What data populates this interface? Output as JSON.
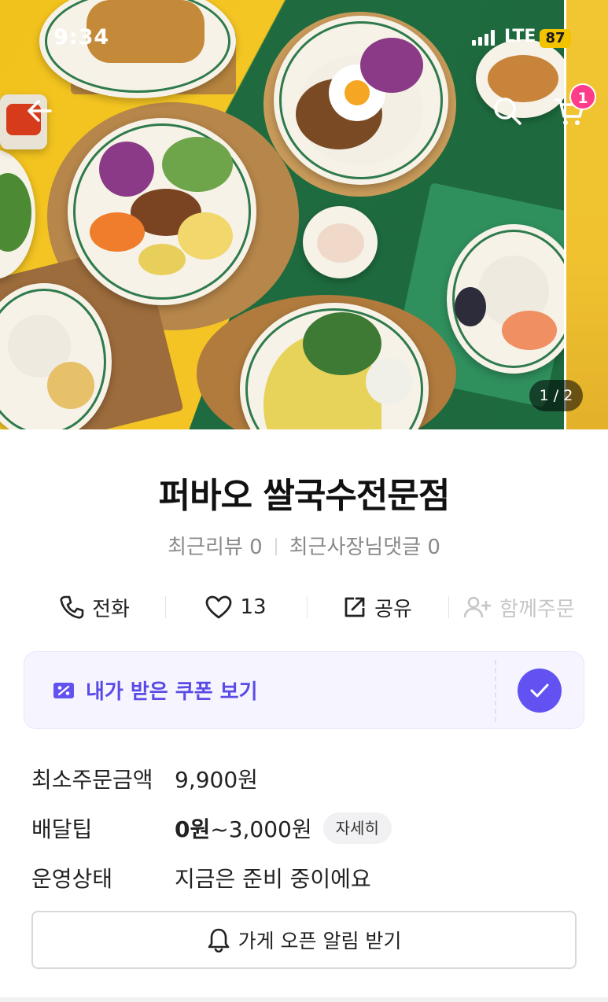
{
  "status_bar": {
    "time": "9:34",
    "network": "LTE",
    "battery": "87"
  },
  "nav": {
    "back_icon": "arrow-left-icon",
    "search_icon": "search-icon",
    "cart_icon": "cart-icon",
    "cart_count": "1"
  },
  "hero": {
    "pager": "1 / 2"
  },
  "store": {
    "name": "퍼바오 쌀국수전문점",
    "recent_reviews": "최근리뷰 0",
    "owner_replies": "최근사장님댓글 0"
  },
  "actions": {
    "call": "전화",
    "likes": "13",
    "share": "공유",
    "group_order": "함께주문"
  },
  "coupon": {
    "label": "내가 받은 쿠폰 보기"
  },
  "info": {
    "min_order_label": "최소주문금액",
    "min_order_value": "9,900원",
    "delivery_tip_label": "배달팁",
    "delivery_tip_min": "0원",
    "delivery_tip_max": "~3,000원",
    "detail_chip": "자세히",
    "status_label": "운영상태",
    "status_value": "지금은 준비 중이에요"
  },
  "notify_button": "가게 오픈 알림 받기",
  "colors": {
    "accent": "#6152f1",
    "closed": "#f1473c",
    "badge": "#ff3c8a"
  }
}
